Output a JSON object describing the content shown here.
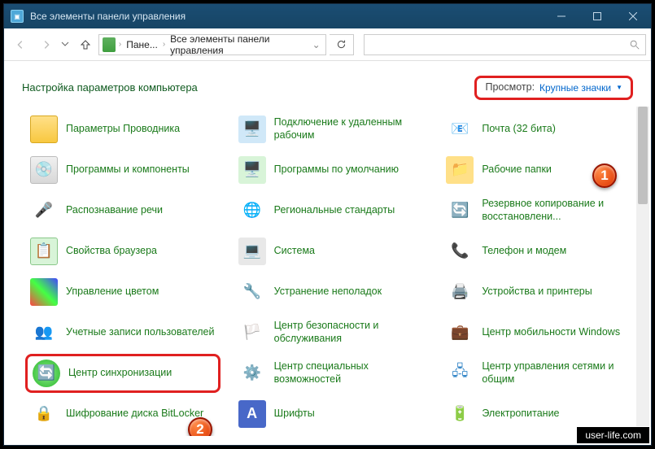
{
  "titlebar": {
    "title": "Все элементы панели управления"
  },
  "nav": {
    "crumb1": "Пане...",
    "crumb2": "Все элементы панели управления"
  },
  "header": {
    "title": "Настройка параметров компьютера",
    "view_label": "Просмотр:",
    "view_value": "Крупные значки"
  },
  "badges": {
    "b1": "1",
    "b2": "2"
  },
  "items": {
    "c1r1": "Параметры Проводника",
    "c1r2": "Программы и компоненты",
    "c1r3": "Распознавание речи",
    "c1r4": "Свойства браузера",
    "c1r5": "Управление цветом",
    "c1r6": "Учетные записи пользователей",
    "c1r7": "Центр синхронизации",
    "c1r8": "Шифрование диска BitLocker",
    "c2r1": "Подключение к удаленным рабочим",
    "c2r2": "Программы по умолчанию",
    "c2r3": "Региональные стандарты",
    "c2r4": "Система",
    "c2r5": "Устранение неполадок",
    "c2r6": "Центр безопасности и обслуживания",
    "c2r7": "Центр специальных возможностей",
    "c2r8": "Шрифты",
    "c3r1": "Почта (32 бита)",
    "c3r2": "Рабочие папки",
    "c3r3": "Резервное копирование и восстановлени...",
    "c3r4": "Телефон и модем",
    "c3r5": "Устройства и принтеры",
    "c3r6": "Центр мобильности Windows",
    "c3r7": "Центр управления сетями и общим",
    "c3r8": "Электропитание"
  },
  "credit": "user-life.com"
}
